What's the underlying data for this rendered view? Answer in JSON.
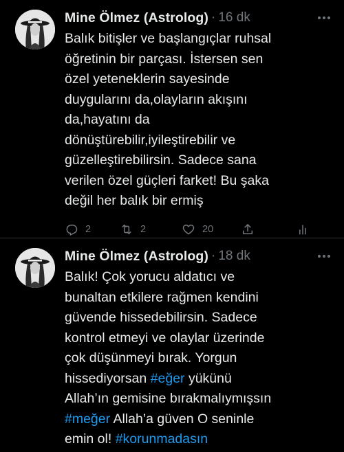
{
  "tweets": [
    {
      "author": "Mine Ölmez (Astrolog)",
      "separator": "·",
      "time": "16 dk",
      "lines": [
        "Balık bitişler ve başlangıçlar ruhsal",
        "öğretinin bir parçası. İstersen sen",
        "özel yeteneklerin sayesinde",
        "duygularını da,olayların akışını",
        "da,hayatını da",
        "dönüştürebilir,iyileştirebilir ve",
        "güzelleştirebilirsin. Sadece sana",
        "verilen özel güçleri farket! Bu şaka",
        "değil her balık bir ermiş"
      ],
      "replies": "2",
      "retweets": "2",
      "likes": "20"
    },
    {
      "author": "Mine Ölmez (Astrolog)",
      "separator": "·",
      "time": "18 dk",
      "line1": "Balık! Çok yorucu aldatıcı ve",
      "line2": "bunaltan etkilere rağmen kendini",
      "line3": "güvende hissedebilirsin. Sadece",
      "line4": "kontrol etmeyi ve olaylar üzerinde",
      "line5": "çok düşünmeyi bırak. Yorgun",
      "line6_pre": "hissediyorsan ",
      "line6_tag": "#eğer",
      "line6_post": " yükünü",
      "line7": "Allah’ın gemisine bırakmalıymışsın",
      "line8_tag": "#meğer",
      "line8_post": " Allah’a güven O seninle",
      "line9_pre": "emin ol! ",
      "line9_tag": "#korunmadasın"
    }
  ],
  "colors": {
    "background": "#000000",
    "text": "#e7e9ea",
    "muted": "#71767b",
    "link": "#1d9bf0",
    "divider": "#2f3336"
  },
  "icons": [
    "more-icon",
    "reply-icon",
    "retweet-icon",
    "like-icon",
    "share-icon",
    "analytics-icon"
  ]
}
